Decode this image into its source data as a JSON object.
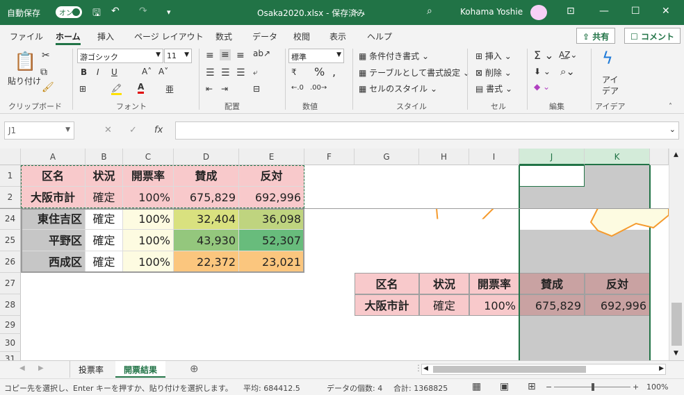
{
  "titlebar": {
    "autosave_label": "自動保存",
    "autosave_state": "オン",
    "file_title": "Osaka2020.xlsx - 保存済み",
    "title_arrow": "⌄",
    "user_name": "Kohama Yoshie"
  },
  "tabs": [
    "ファイル",
    "ホーム",
    "挿入",
    "ページ レイアウト",
    "数式",
    "データ",
    "校閲",
    "表示",
    "ヘルプ"
  ],
  "share_label": "共有",
  "comment_label": "コメント",
  "ribbon": {
    "paste_label": "貼り付け",
    "font_name": "游ゴシック",
    "font_size": "11",
    "number_format": "標準",
    "cond_format": "条件付き書式",
    "table_format": "テーブルとして書式設定",
    "cell_style": "セルのスタイル",
    "insert": "挿入",
    "delete": "削除",
    "format": "書式",
    "idea_line1": "アイ",
    "idea_line2": "デア",
    "groups": {
      "clipboard": "クリップボード",
      "font": "フォント",
      "alignment": "配置",
      "number": "数値",
      "style": "スタイル",
      "cells": "セル",
      "editing": "編集",
      "ideas": "アイデア"
    }
  },
  "namebox": "J1",
  "fx_label": "fx",
  "columns": [
    "A",
    "B",
    "C",
    "D",
    "E",
    "F",
    "G",
    "H",
    "I",
    "J",
    "K"
  ],
  "rows": [
    "1",
    "2",
    "24",
    "25",
    "26",
    "27",
    "28",
    "29",
    "30",
    "31"
  ],
  "table": {
    "header": [
      "区名",
      "状況",
      "開票率",
      "賛成",
      "反対"
    ],
    "total": [
      "大阪市計",
      "確定",
      "100%",
      "675,829",
      "692,996"
    ],
    "r24": [
      "東住吉区",
      "確定",
      "100%",
      "32,404",
      "36,098"
    ],
    "r25": [
      "平野区",
      "確定",
      "100%",
      "43,930",
      "52,307"
    ],
    "r26": [
      "西成区",
      "確定",
      "100%",
      "22,372",
      "23,021"
    ]
  },
  "summary": {
    "header": [
      "区名",
      "状況",
      "開票率",
      "賛成",
      "反対"
    ],
    "row": [
      "大阪市計",
      "確定",
      "100%",
      "675,829",
      "692,996"
    ]
  },
  "colors": {
    "excel_green": "#217346",
    "pink_header": "#f8c9cb",
    "label_gray": "#c6c6c6",
    "rate_yellow": "#fdfbe1",
    "selection_gray": "#c9c9c9",
    "darkpink": "#c9a2a2"
  },
  "sheets": [
    "投票率",
    "開票結果"
  ],
  "status": {
    "message": "コピー先を選択し、Enter キーを押すか、貼り付けを選択します。",
    "average": "平均: 684412.5",
    "count": "データの個数: 4",
    "sum": "合計: 1368825",
    "zoom": "100%"
  }
}
